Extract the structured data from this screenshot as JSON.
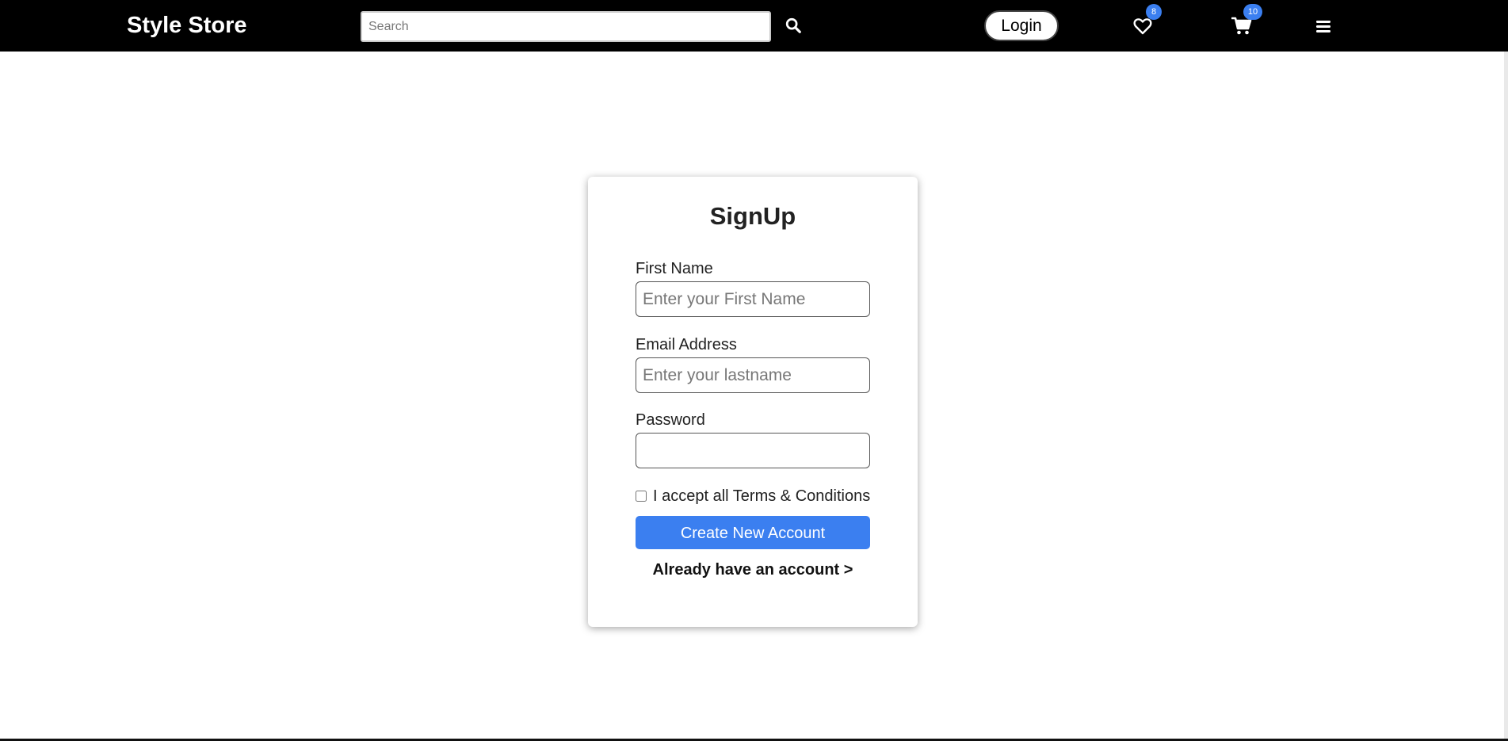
{
  "navbar": {
    "brand": "Style Store",
    "search_placeholder": "Search",
    "login_label": "Login",
    "wishlist_count": "8",
    "cart_count": "10"
  },
  "signup": {
    "title": "SignUp",
    "first_name_label": "First Name",
    "first_name_placeholder": "Enter your First Name",
    "email_label": "Email Address",
    "email_placeholder": "Enter your lastname",
    "password_label": "Password",
    "terms_label": "I accept all Terms & Conditions",
    "create_button": "Create New Account",
    "login_link": "Already have an account >"
  },
  "colors": {
    "navbar_bg": "#000000",
    "accent": "#3b7ff0"
  },
  "icons": {
    "search": "search-icon",
    "wishlist": "heart-icon",
    "cart": "shopping-cart-icon",
    "menu": "hamburger-menu-icon"
  }
}
